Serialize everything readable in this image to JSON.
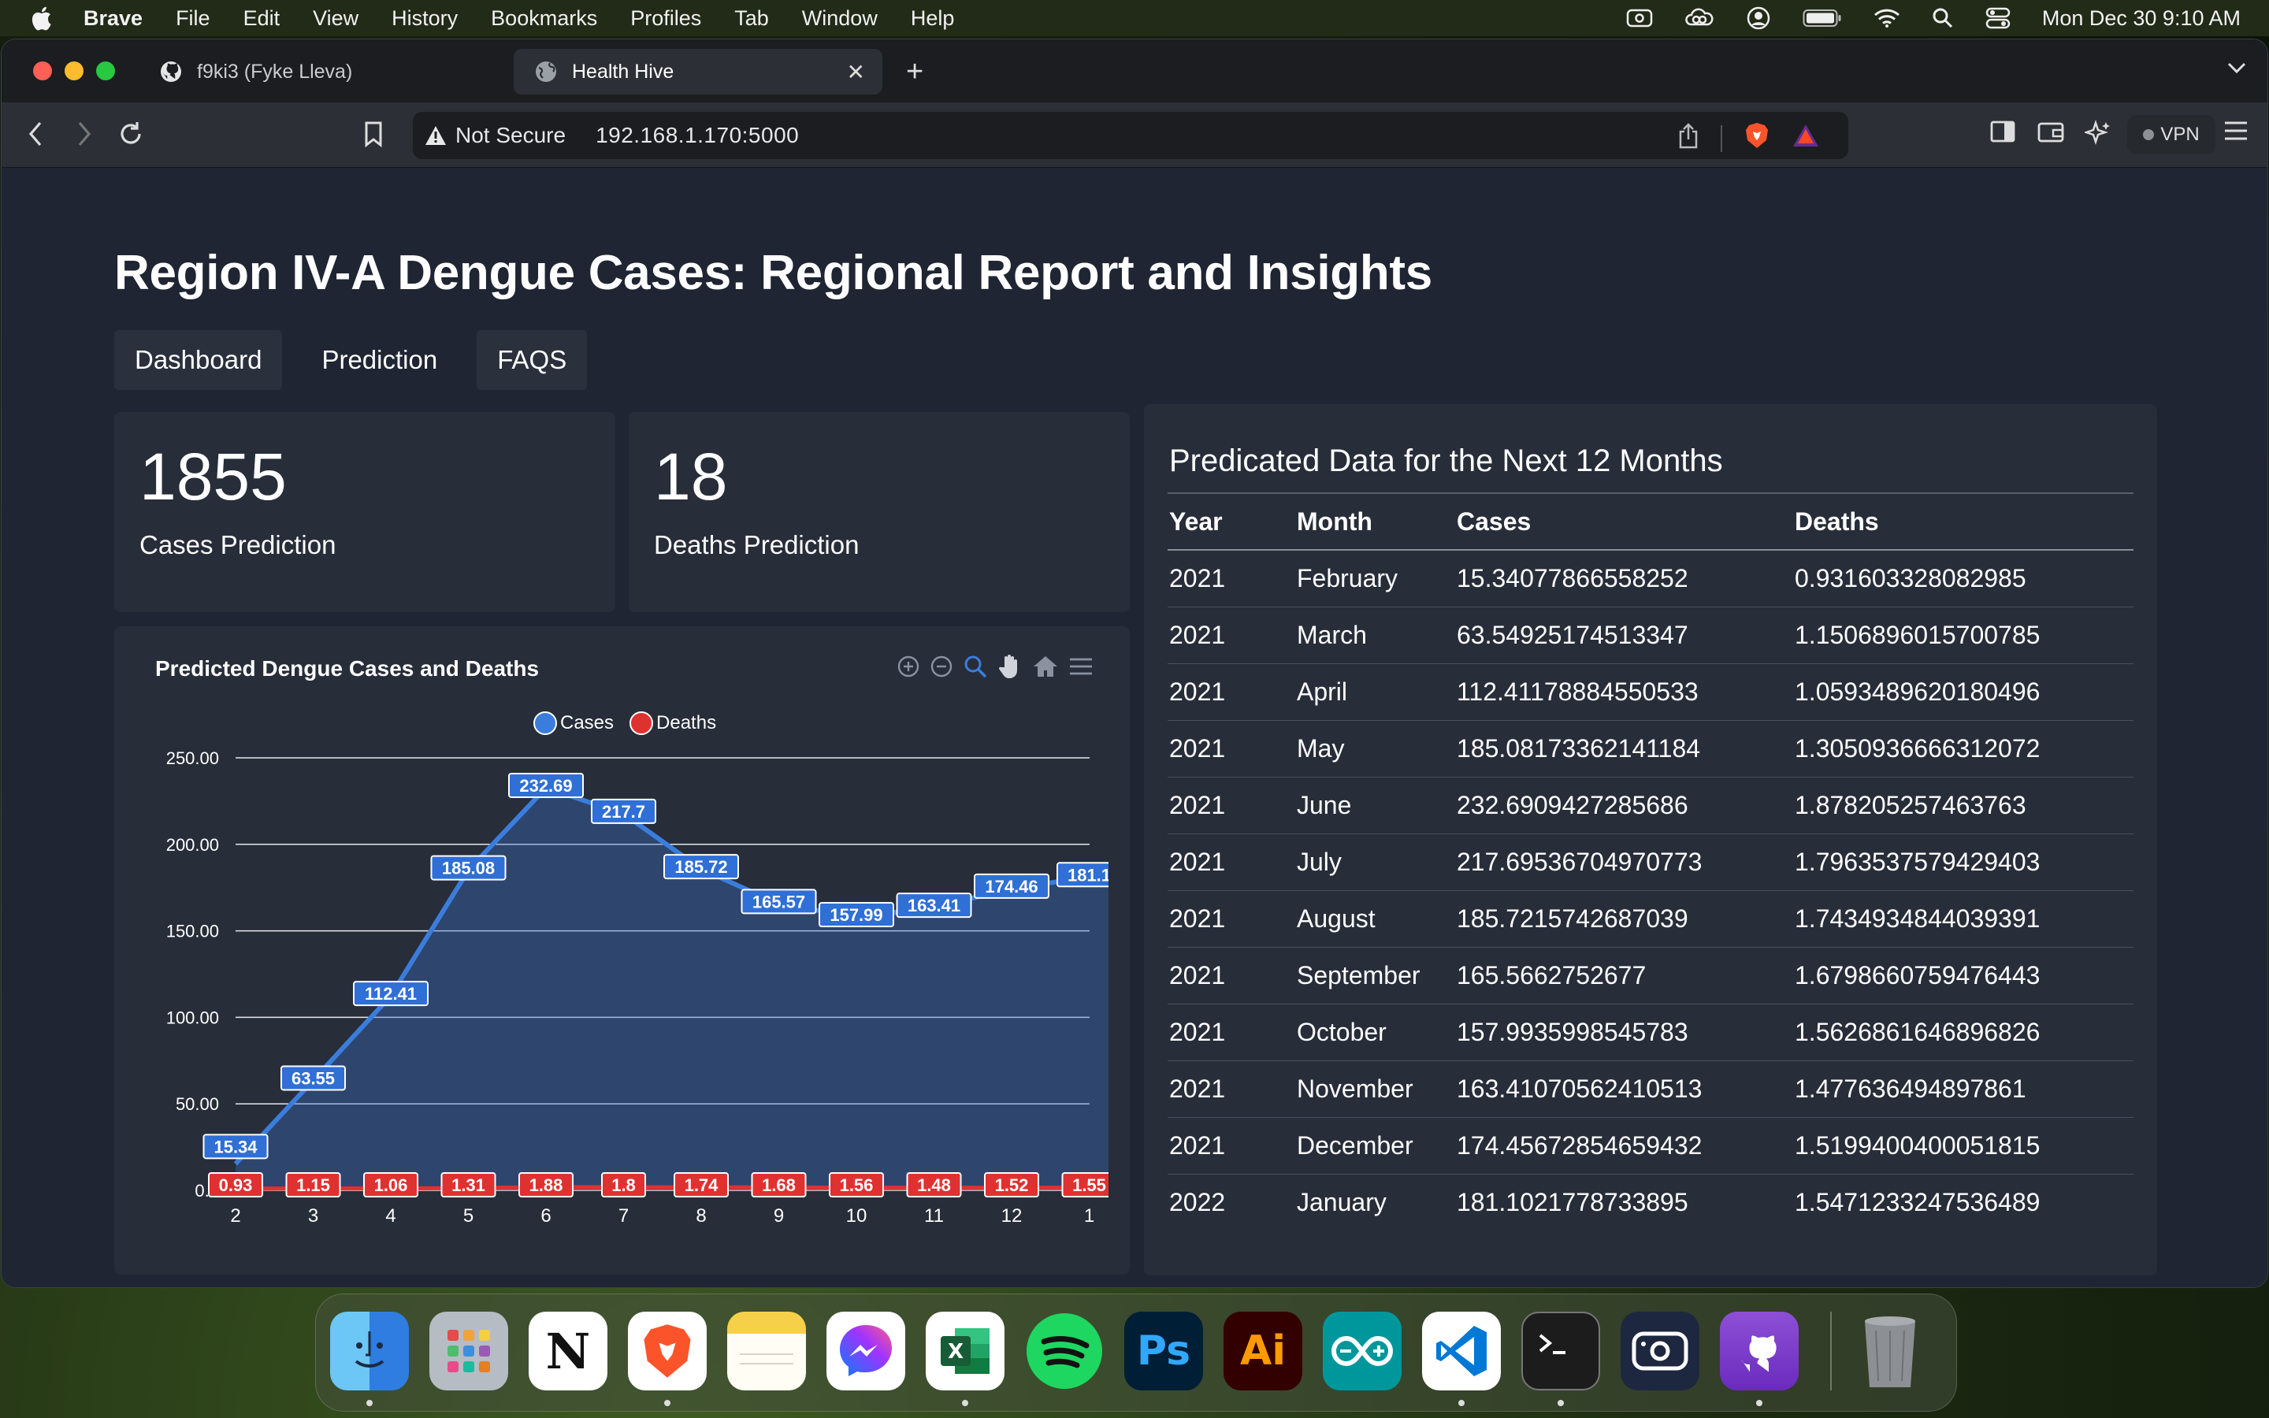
{
  "menubar": {
    "app_name": "Brave",
    "items": [
      "File",
      "Edit",
      "View",
      "History",
      "Bookmarks",
      "Profiles",
      "Tab",
      "Window",
      "Help"
    ],
    "clock": "Mon Dec 30  9:10 AM"
  },
  "browser": {
    "tabs": [
      {
        "label": "f9ki3 (Fyke Lleva)",
        "icon": "github-icon",
        "active": false
      },
      {
        "label": "Health Hive",
        "icon": "globe-icon",
        "active": true
      }
    ],
    "url": {
      "security_label": "Not Secure",
      "address": "192.168.1.170:5000"
    },
    "vpn_label": "VPN"
  },
  "page": {
    "title": "Region IV-A Dengue Cases: Regional Report and Insights",
    "nav": [
      "Dashboard",
      "Prediction",
      "FAQS"
    ],
    "stats": {
      "cases_value": "1855",
      "cases_label": "Cases Prediction",
      "deaths_value": "18",
      "deaths_label": "Deaths Prediction"
    },
    "chart_title": "Predicted Dengue Cases and Deaths",
    "table": {
      "title": "Predicated Data for the Next 12 Months",
      "headers": [
        "Year",
        "Month",
        "Cases",
        "Deaths"
      ],
      "rows": [
        [
          "2021",
          "February",
          "15.34077866558252",
          "0.931603328082985"
        ],
        [
          "2021",
          "March",
          "63.54925174513347",
          "1.1506896015700785"
        ],
        [
          "2021",
          "April",
          "112.41178884550533",
          "1.0593489620180496"
        ],
        [
          "2021",
          "May",
          "185.08173362141184",
          "1.3050936666312072"
        ],
        [
          "2021",
          "June",
          "232.6909427285686",
          "1.878205257463763"
        ],
        [
          "2021",
          "July",
          "217.69536704970773",
          "1.7963537579429403"
        ],
        [
          "2021",
          "August",
          "185.7215742687039",
          "1.7434934844039391"
        ],
        [
          "2021",
          "September",
          "165.5662752677",
          "1.6798660759476443"
        ],
        [
          "2021",
          "October",
          "157.9935998545783",
          "1.5626861646896826"
        ],
        [
          "2021",
          "November",
          "163.41070562410513",
          "1.477636494897861"
        ],
        [
          "2021",
          "December",
          "174.45672854659432",
          "1.5199400400051815"
        ],
        [
          "2022",
          "January",
          "181.1021778733895",
          "1.5471233247536489"
        ]
      ]
    }
  },
  "chart_data": {
    "type": "area",
    "title": "Predicted Dengue Cases and Deaths",
    "x": [
      "2",
      "3",
      "4",
      "5",
      "6",
      "7",
      "8",
      "9",
      "10",
      "11",
      "12",
      "1"
    ],
    "series": [
      {
        "name": "Cases",
        "color": "#3b7ddd",
        "values": [
          15.34,
          63.55,
          112.41,
          185.08,
          232.69,
          217.7,
          185.72,
          165.57,
          157.99,
          163.41,
          174.46,
          181.1
        ],
        "labels": [
          "15.34",
          "63.55",
          "112.41",
          "185.08",
          "232.69",
          "217.7",
          "185.72",
          "165.57",
          "157.99",
          "163.41",
          "174.46",
          "181.1"
        ]
      },
      {
        "name": "Deaths",
        "color": "#e03131",
        "values": [
          0.93,
          1.15,
          1.06,
          1.31,
          1.88,
          1.8,
          1.74,
          1.68,
          1.56,
          1.48,
          1.52,
          1.55
        ],
        "labels": [
          "0.93",
          "1.15",
          "1.06",
          "1.31",
          "1.88",
          "1.8",
          "1.74",
          "1.68",
          "1.56",
          "1.48",
          "1.52",
          "1.55"
        ]
      }
    ],
    "y_ticks": [
      "250.00",
      "200.00",
      "150.00",
      "100.00",
      "50.00",
      "0.0"
    ],
    "ylim": [
      0,
      250
    ],
    "legend": "top-center",
    "grid": true
  },
  "colors": {
    "page_bg": "#1f2532",
    "card_bg": "#272d39",
    "cases": "#3b7ddd",
    "deaths": "#e03131"
  },
  "dock": [
    "finder-icon",
    "launchpad-icon",
    "notion-icon",
    "brave-icon",
    "notes-icon",
    "messenger-icon",
    "excel-icon",
    "spotify-icon",
    "photoshop-icon",
    "illustrator-icon",
    "arduino-icon",
    "vscode-icon",
    "terminal-icon",
    "screenshot-icon",
    "github-desktop-icon",
    "trash-icon"
  ]
}
